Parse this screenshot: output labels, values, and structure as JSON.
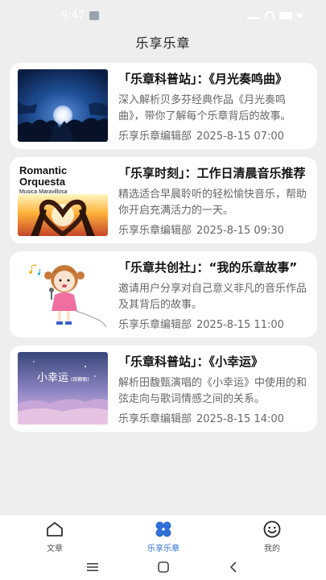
{
  "status_bar": {
    "time": "9:47"
  },
  "header": {
    "title": "乐享乐章"
  },
  "articles": [
    {
      "title": "「乐章科普站」：《月光奏鸣曲》",
      "summary": "深入解析贝多芬经典作品《月光奏鸣曲》，带你了解每个乐章背后的故事。",
      "author": "乐享乐章编辑部",
      "date": "2025-8-15 07:00",
      "image_icon": "moon-night-image"
    },
    {
      "title": "「乐享时刻」：工作日清晨音乐推荐",
      "summary": "精选适合早晨聆听的轻松愉快音乐，帮助你开启充满活力的一天。",
      "author": "乐享乐章编辑部",
      "date": "2025-8-15 09:30",
      "image_icon": "romantic-orquesta-album-image",
      "image_text": {
        "line1": "Romantic",
        "line2": "Orquesta",
        "line3": "Musica Maravillosa"
      }
    },
    {
      "title": "「乐章共创社」：“我的乐章故事”",
      "summary": "邀请用户分享对自己意义非凡的音乐作品及其背后的故事。",
      "author": "乐享乐章编辑部",
      "date": "2025-8-15 11:00",
      "image_icon": "singing-girl-image"
    },
    {
      "title": "「乐章科普站」：《小幸运》",
      "summary": "解析田馥甄演唱的《小幸运》中使用的和弦走向与歌词情感之间的关系。",
      "author": "乐享乐章编辑部",
      "date": "2025-8-15 14:00",
      "image_icon": "xiao-xing-yun-cover-image",
      "image_text": {
        "line1": "小幸运",
        "line2": "(田馥甄)"
      }
    }
  ],
  "tabbar": {
    "tabs": [
      {
        "label": "文章",
        "icon": "home-icon",
        "active": false
      },
      {
        "label": "乐享乐章",
        "icon": "four-petal-icon",
        "active": true
      },
      {
        "label": "我的",
        "icon": "smiley-icon",
        "active": false
      }
    ],
    "colors": {
      "active": "#2f6fd6",
      "inactive": "#555555"
    }
  }
}
